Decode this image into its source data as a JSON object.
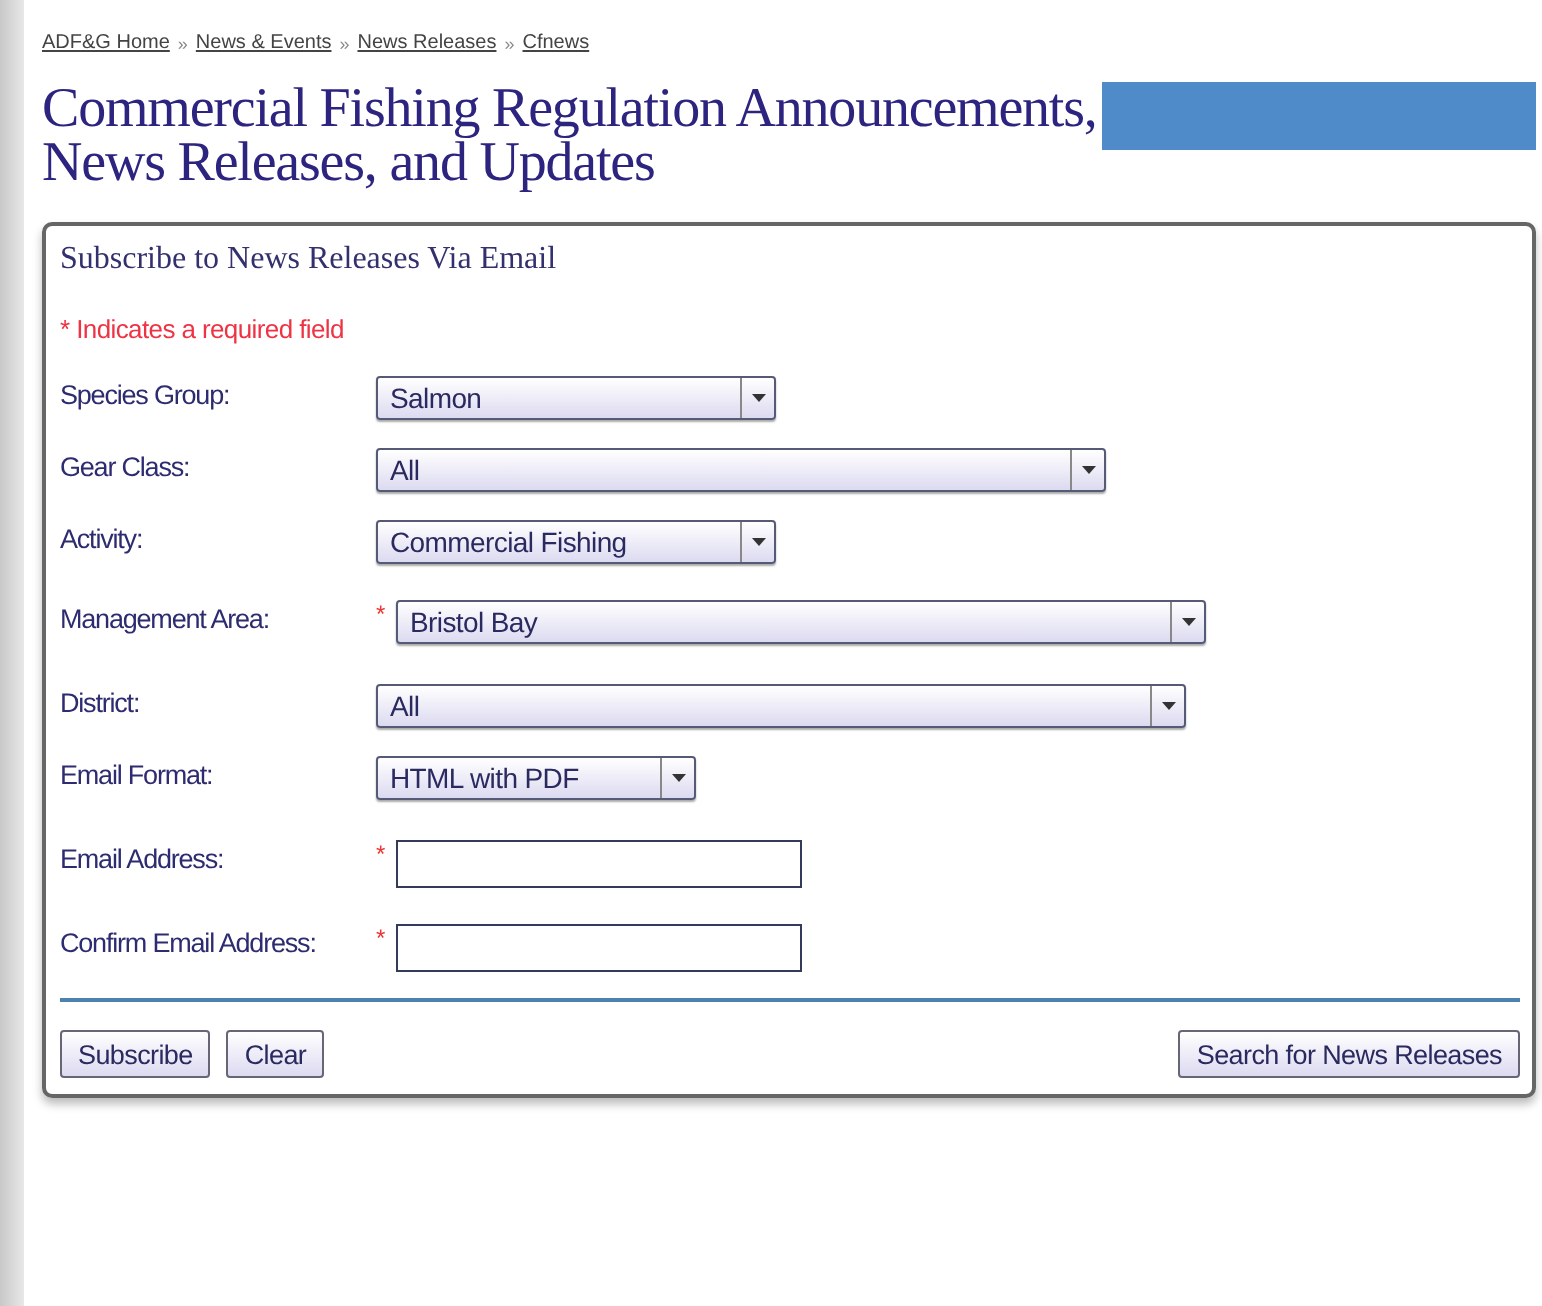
{
  "breadcrumb": [
    "ADF&G Home",
    "News & Events",
    "News Releases",
    "Cfnews"
  ],
  "breadcrumb_separator": "»",
  "title": "Commercial Fishing Regulation Announcements, News Releases, and Updates",
  "form": {
    "heading": "Subscribe to News Releases Via Email",
    "required_note": "* Indicates a required field",
    "fields": [
      {
        "label": "Species Group:",
        "kind": "select",
        "required": false,
        "value": "Salmon"
      },
      {
        "label": "Gear Class:",
        "kind": "select",
        "required": false,
        "value": "All"
      },
      {
        "label": "Activity:",
        "kind": "select",
        "required": false,
        "value": "Commercial Fishing"
      },
      {
        "label": "Management Area:",
        "kind": "select",
        "required": true,
        "value": "Bristol Bay"
      },
      {
        "label": "District:",
        "kind": "select",
        "required": false,
        "value": "All"
      },
      {
        "label": "Email Format:",
        "kind": "select",
        "required": false,
        "value": "HTML with PDF"
      },
      {
        "label": "Email Address:",
        "kind": "input",
        "required": true
      },
      {
        "label": "Confirm Email Address:",
        "kind": "input",
        "required": true
      }
    ],
    "required_mark": "*",
    "buttons": [
      "Subscribe",
      "Clear"
    ],
    "search_button": "Search for News Releases"
  }
}
